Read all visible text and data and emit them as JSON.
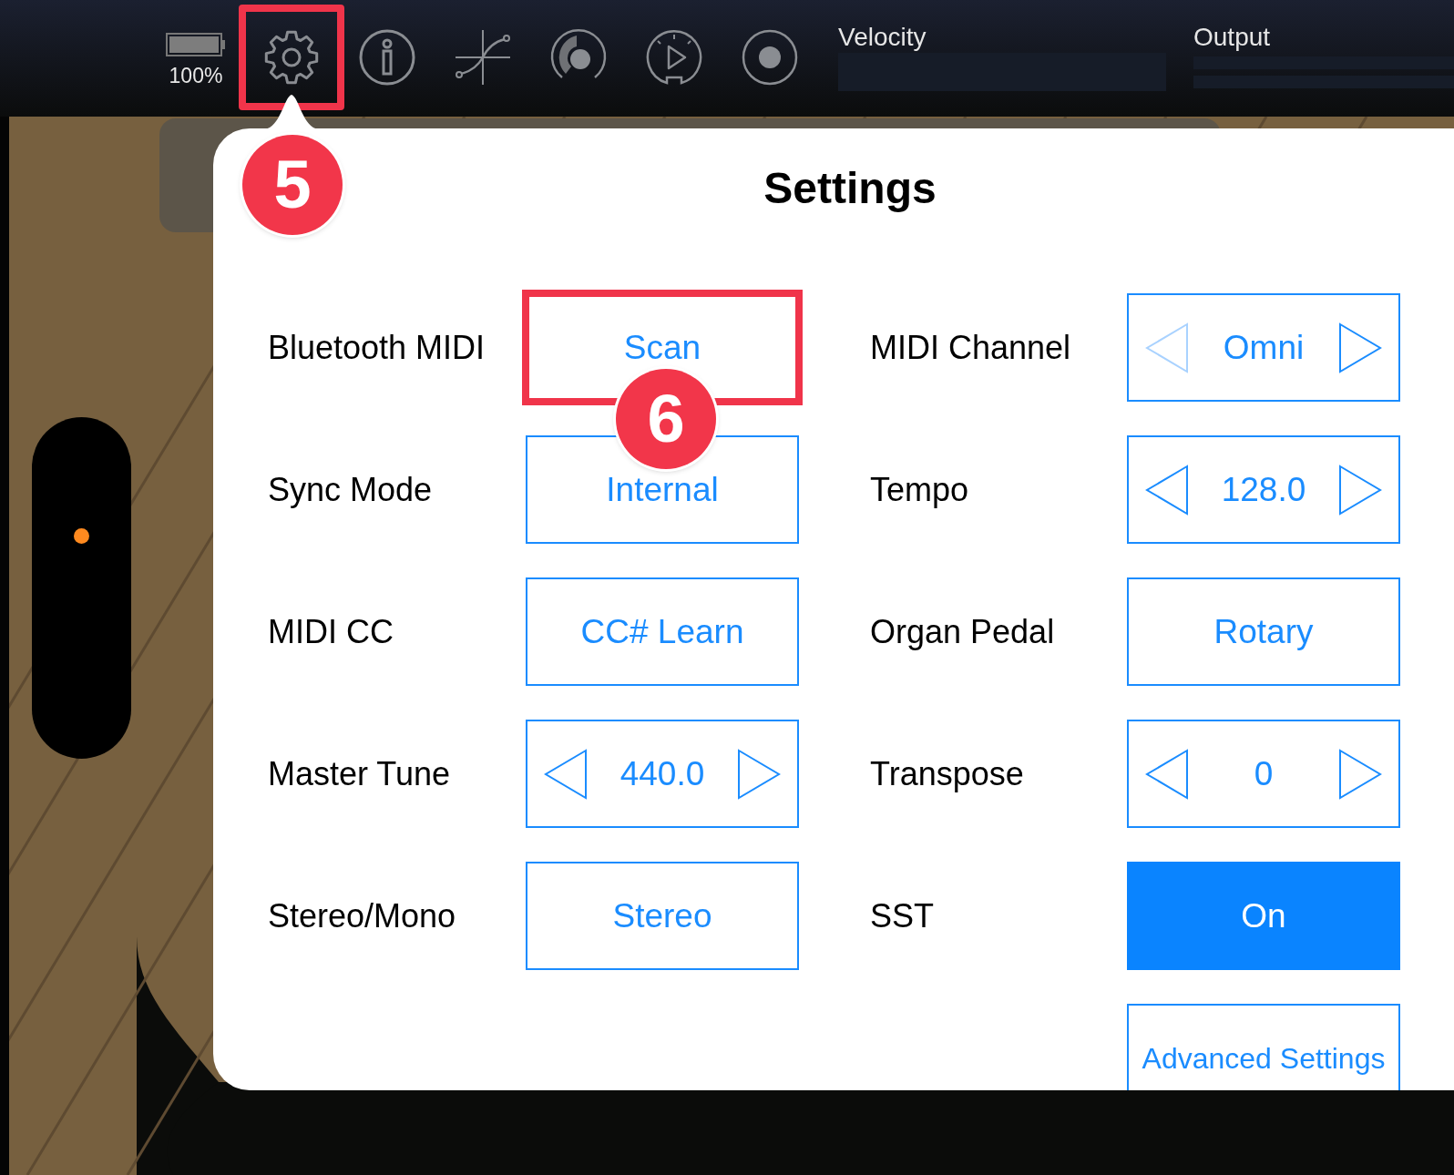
{
  "toolbar": {
    "battery_label": "100%",
    "icons": [
      {
        "kind": "gear",
        "highlighted": true
      },
      {
        "kind": "info",
        "highlighted": false
      },
      {
        "kind": "curve",
        "highlighted": false
      },
      {
        "kind": "knob",
        "highlighted": false
      },
      {
        "kind": "play-dial",
        "highlighted": false
      },
      {
        "kind": "record",
        "highlighted": false
      }
    ],
    "meters": [
      {
        "label": "Velocity",
        "kind": "single"
      },
      {
        "label": "Output",
        "kind": "stereo"
      }
    ]
  },
  "settings": {
    "title": "Settings",
    "items": [
      {
        "label": "Bluetooth MIDI",
        "control": {
          "kind": "button",
          "value": "Scan",
          "highlighted": true
        }
      },
      {
        "label": "MIDI Channel",
        "control": {
          "kind": "stepper",
          "value": "Omni",
          "prev_disabled": true
        }
      },
      {
        "label": "Sync Mode",
        "control": {
          "kind": "button",
          "value": "Internal",
          "highlighted": false
        }
      },
      {
        "label": "Tempo",
        "control": {
          "kind": "stepper",
          "value": "128.0",
          "prev_disabled": false
        }
      },
      {
        "label": "MIDI CC",
        "control": {
          "kind": "button",
          "value": "CC# Learn",
          "highlighted": false
        }
      },
      {
        "label": "Organ Pedal",
        "control": {
          "kind": "button",
          "value": "Rotary",
          "highlighted": false
        }
      },
      {
        "label": "Master Tune",
        "control": {
          "kind": "stepper",
          "value": "440.0",
          "prev_disabled": false
        }
      },
      {
        "label": "Transpose",
        "control": {
          "kind": "stepper",
          "value": "0",
          "prev_disabled": false
        }
      },
      {
        "label": "Stereo/Mono",
        "control": {
          "kind": "button",
          "value": "Stereo",
          "highlighted": false
        }
      },
      {
        "label": "SST",
        "control": {
          "kind": "toggle",
          "value": "On",
          "on": true
        }
      }
    ],
    "advanced_button": "Advanced Settings"
  },
  "wheel": {
    "level": 0.68
  },
  "annotations": [
    {
      "label": "5"
    },
    {
      "label": "6"
    }
  ]
}
